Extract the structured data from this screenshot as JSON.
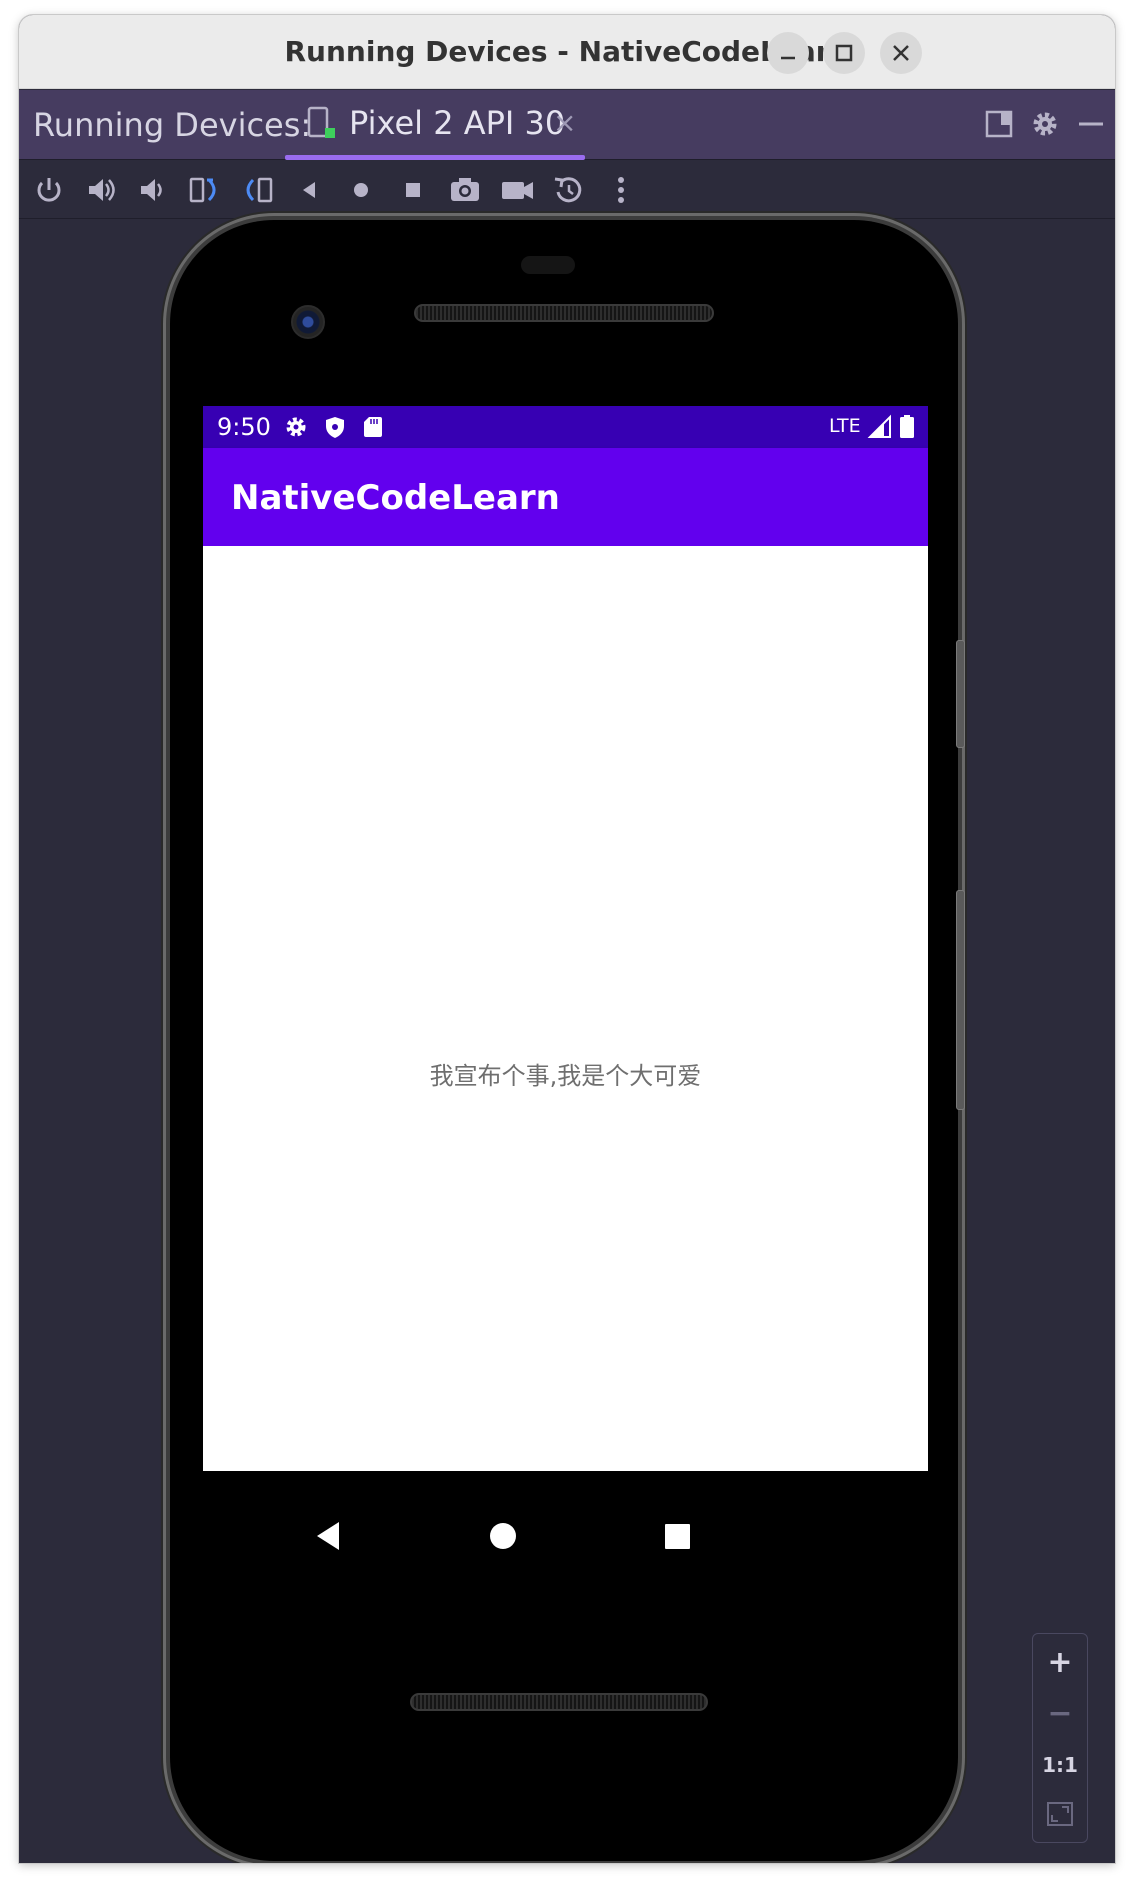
{
  "window": {
    "title": "Running Devices - NativeCodeLearn",
    "buttons": [
      "minimize",
      "maximize",
      "close"
    ]
  },
  "tool_window": {
    "header_label": "Running Devices:",
    "tab": {
      "label": "Pixel 2 API 30",
      "close_glyph": "×",
      "icon": "device-icon"
    },
    "header_actions": [
      "layout-icon",
      "gear-icon",
      "minimize-icon"
    ],
    "accent_color": "#9a6cf0"
  },
  "toolbar": {
    "buttons": [
      "power-icon",
      "volume-up-icon",
      "volume-down-icon",
      "rotate-left-icon",
      "rotate-right-icon",
      "back-icon",
      "home-icon",
      "overview-icon",
      "camera-icon",
      "video-icon",
      "snapshot-icon",
      "more-icon"
    ]
  },
  "device": {
    "status_bar": {
      "time": "9:50",
      "network": "LTE",
      "icons": [
        "settings-icon",
        "shield-icon",
        "sd-card-icon",
        "signal-icon",
        "battery-icon"
      ],
      "color": "#3700b3"
    },
    "app_bar": {
      "title": "NativeCodeLearn",
      "color": "#6200ee"
    },
    "content": {
      "message": "我宣布个事,我是个大可爱"
    },
    "nav_bar": [
      "nav-back-icon",
      "nav-home-icon",
      "nav-recents-icon"
    ]
  },
  "zoom": {
    "zoom_in": "+",
    "zoom_out": "−",
    "actual_size": "1:1",
    "fit_icon": "fit-screen-icon"
  }
}
